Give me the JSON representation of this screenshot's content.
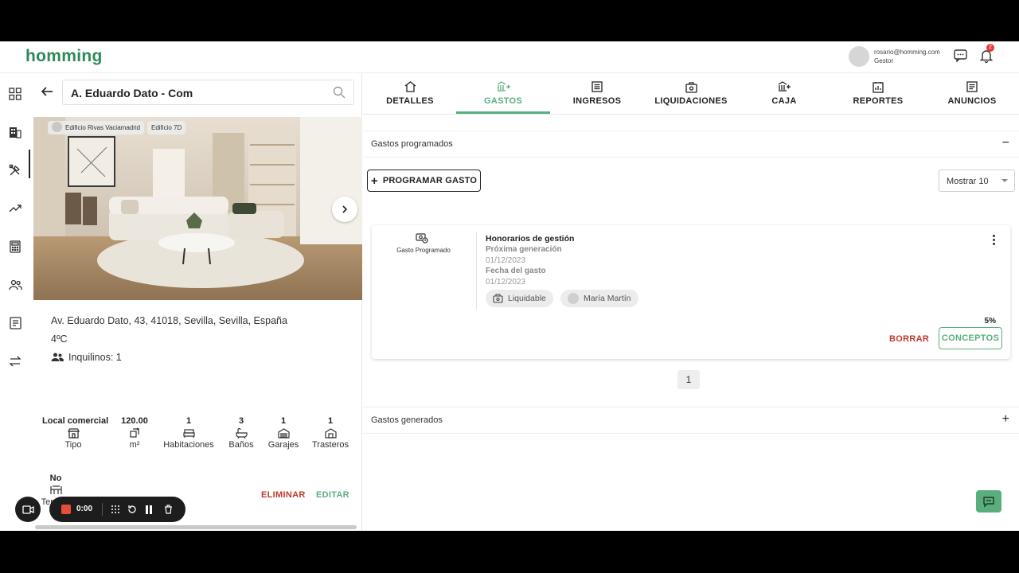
{
  "header": {
    "logo": "homming",
    "user_email": "rosario@homming.com",
    "user_role": "Gestor",
    "notifications_count": "2"
  },
  "rail": {
    "items": [
      "dashboard-icon",
      "building-icon",
      "tools-icon",
      "trending-icon",
      "calculator-icon",
      "people-icon",
      "contract-icon",
      "transfer-icon"
    ],
    "active_index": 1
  },
  "property": {
    "search_value": "A. Eduardo Dato - Com",
    "photo_tags": [
      "Edificio Rivas Vaciamadrid",
      "Edificio 7D"
    ],
    "address": "Av. Eduardo Dato, 43, 41018, Sevilla, Sevilla, España",
    "floor": "4ºC",
    "tenants": "Inquilinos: 1",
    "features": [
      {
        "value": "Local comercial",
        "label": "Tipo",
        "icon": "shop-icon"
      },
      {
        "value": "120.00",
        "label": "m²",
        "icon": "area-icon"
      },
      {
        "value": "1",
        "label": "Habitaciones",
        "icon": "bed-icon"
      },
      {
        "value": "3",
        "label": "Baños",
        "icon": "bath-icon"
      },
      {
        "value": "1",
        "label": "Garajes",
        "icon": "garage-icon"
      },
      {
        "value": "1",
        "label": "Trasteros",
        "icon": "storage-icon"
      },
      {
        "value": "No",
        "label": "Terraza",
        "icon": "terrace-icon"
      }
    ],
    "delete_label": "ELIMINAR",
    "edit_label": "EDITAR"
  },
  "tabs": [
    {
      "label": "DETALLES",
      "icon": "home-icon"
    },
    {
      "label": "GASTOS",
      "icon": "expenses-icon"
    },
    {
      "label": "INGRESOS",
      "icon": "income-icon"
    },
    {
      "label": "LIQUIDACIONES",
      "icon": "settlement-icon"
    },
    {
      "label": "CAJA",
      "icon": "cash-icon"
    },
    {
      "label": "REPORTES",
      "icon": "report-icon"
    },
    {
      "label": "ANUNCIOS",
      "icon": "ads-icon"
    }
  ],
  "active_tab": 1,
  "scheduled": {
    "title": "Gastos programados",
    "toggle": "−",
    "program_button": "PROGRAMAR GASTO",
    "show_select": "Mostrar 10",
    "card": {
      "type_label": "Gasto Programado",
      "title": "Honorarios de gestión",
      "next_label": "Próxima generación",
      "next_date": "01/12/2023",
      "date_label": "Fecha del gasto",
      "date_value": "01/12/2023",
      "pill_liquidable": "Liquidable",
      "pill_person": "María Martín",
      "percent": "5%",
      "delete_button": "BORRAR",
      "concepts_button": "CONCEPTOS"
    },
    "page": "1"
  },
  "generated": {
    "title": "Gastos generados",
    "toggle": "+"
  },
  "recorder": {
    "time": "0:00"
  },
  "colors": {
    "brand": "#2e8b57",
    "accent": "#5aae7d",
    "danger": "#c0392b"
  }
}
